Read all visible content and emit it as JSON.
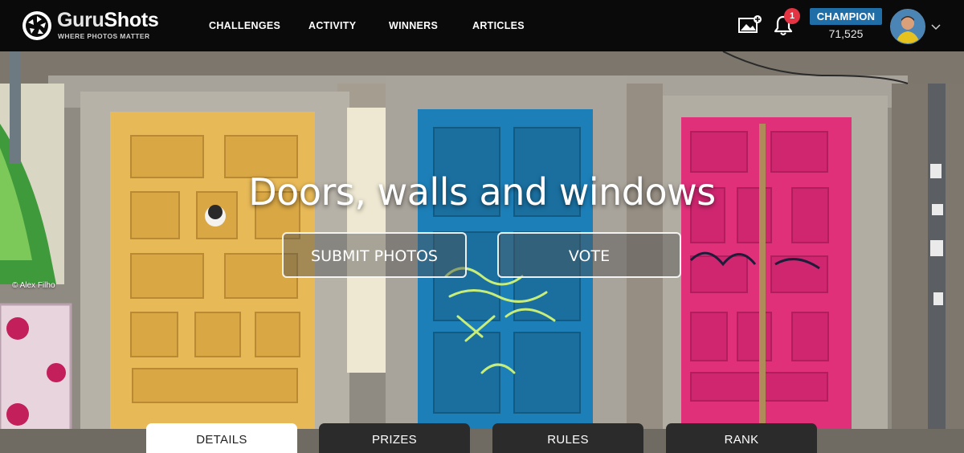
{
  "header": {
    "brand_prefix": "Guru",
    "brand_suffix": "Shots",
    "tagline": "WHERE PHOTOS MATTER",
    "nav": [
      "CHALLENGES",
      "ACTIVITY",
      "WINNERS",
      "ARTICLES"
    ],
    "notifications_count": "1",
    "rank_label": "CHAMPION",
    "points": "71,525",
    "icons": [
      "camera-shutter-logo-icon",
      "add-photo-icon",
      "bell-icon",
      "user-avatar",
      "chevron-down-icon"
    ]
  },
  "hero": {
    "title": "Doors, walls and windows",
    "submit_label": "SUBMIT PHOTOS",
    "vote_label": "VOTE",
    "photo_credit": "© Alex Filho"
  },
  "tabs": [
    {
      "label": "DETAILS",
      "active": true
    },
    {
      "label": "PRIZES",
      "active": false
    },
    {
      "label": "RULES",
      "active": false
    },
    {
      "label": "RANK",
      "active": false
    }
  ],
  "colors": {
    "header_bg": "#0a0a0a",
    "rank_badge": "#1f6ea8",
    "notification_badge": "#e23442",
    "door_yellow": "#e8b957",
    "door_blue": "#1d7fb8",
    "door_pink": "#e0307a"
  }
}
